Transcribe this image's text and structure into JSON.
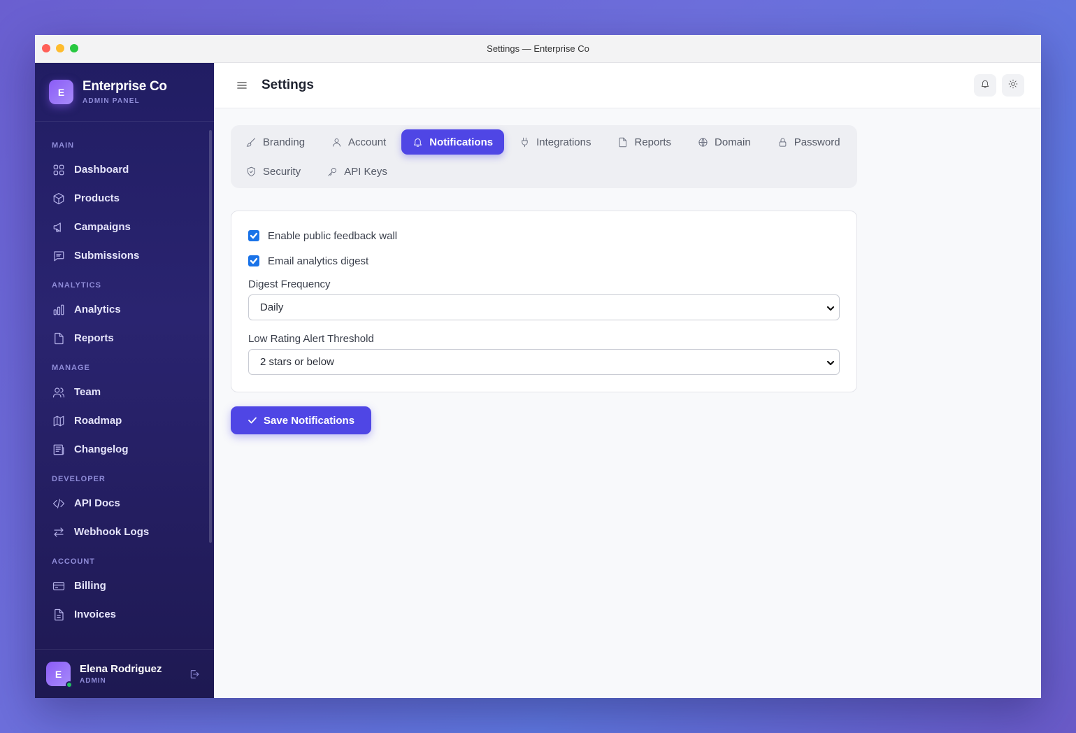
{
  "window": {
    "title": "Settings — Enterprise Co"
  },
  "brand": {
    "name": "Enterprise Co",
    "subtitle": "ADMIN PANEL",
    "logo_letter": "E"
  },
  "sidebar": {
    "sections": [
      {
        "label": "MAIN",
        "items": [
          {
            "label": "Dashboard",
            "icon": "grid-icon"
          },
          {
            "label": "Products",
            "icon": "box-icon"
          },
          {
            "label": "Campaigns",
            "icon": "megaphone-icon"
          },
          {
            "label": "Submissions",
            "icon": "message-icon"
          }
        ]
      },
      {
        "label": "ANALYTICS",
        "items": [
          {
            "label": "Analytics",
            "icon": "bar-chart-icon"
          },
          {
            "label": "Reports",
            "icon": "file-icon"
          }
        ]
      },
      {
        "label": "MANAGE",
        "items": [
          {
            "label": "Team",
            "icon": "users-icon"
          },
          {
            "label": "Roadmap",
            "icon": "map-icon"
          },
          {
            "label": "Changelog",
            "icon": "newspaper-icon"
          }
        ]
      },
      {
        "label": "DEVELOPER",
        "items": [
          {
            "label": "API Docs",
            "icon": "code-icon"
          },
          {
            "label": "Webhook Logs",
            "icon": "arrows-icon"
          }
        ]
      },
      {
        "label": "ACCOUNT",
        "items": [
          {
            "label": "Billing",
            "icon": "credit-card-icon"
          },
          {
            "label": "Invoices",
            "icon": "invoice-icon"
          }
        ]
      }
    ]
  },
  "user": {
    "name": "Elena Rodriguez",
    "role": "ADMIN",
    "avatar_letter": "E"
  },
  "header": {
    "title": "Settings"
  },
  "tabs": [
    {
      "label": "Branding",
      "icon": "brush-icon"
    },
    {
      "label": "Account",
      "icon": "user-icon"
    },
    {
      "label": "Notifications",
      "icon": "bell-icon",
      "active": true
    },
    {
      "label": "Integrations",
      "icon": "plug-icon"
    },
    {
      "label": "Reports",
      "icon": "file-icon"
    },
    {
      "label": "Domain",
      "icon": "globe-icon"
    },
    {
      "label": "Password",
      "icon": "lock-icon"
    },
    {
      "label": "Security",
      "icon": "shield-icon"
    },
    {
      "label": "API Keys",
      "icon": "key-icon"
    }
  ],
  "form": {
    "checkboxes": [
      {
        "label": "Enable public feedback wall",
        "checked": true
      },
      {
        "label": "Email analytics digest",
        "checked": true
      }
    ],
    "digest_frequency": {
      "label": "Digest Frequency",
      "value": "Daily"
    },
    "low_rating_threshold": {
      "label": "Low Rating Alert Threshold",
      "value": "2 stars or below"
    }
  },
  "actions": {
    "save_label": "Save Notifications"
  },
  "colors": {
    "accent": "#4f46e5",
    "checkbox": "#1a73e8",
    "sidebar": "#211d63"
  }
}
